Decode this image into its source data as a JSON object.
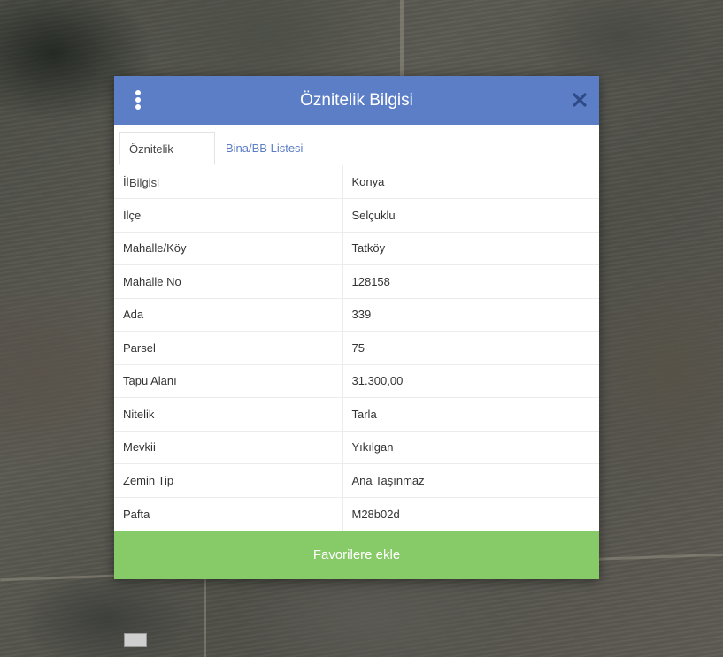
{
  "dialog": {
    "title": "Öznitelik Bilgisi",
    "tabs": [
      {
        "label": "Öznitelik Bilgisi",
        "active": true
      },
      {
        "label": "Bina/BB Listesi",
        "active": false
      }
    ],
    "rows": [
      {
        "key": "İl",
        "value": "Konya"
      },
      {
        "key": "İlçe",
        "value": "Selçuklu"
      },
      {
        "key": "Mahalle/Köy",
        "value": "Tatköy"
      },
      {
        "key": "Mahalle No",
        "value": "128158"
      },
      {
        "key": "Ada",
        "value": "339"
      },
      {
        "key": "Parsel",
        "value": "75"
      },
      {
        "key": "Tapu Alanı",
        "value": "31.300,00"
      },
      {
        "key": "Nitelik",
        "value": "Tarla"
      },
      {
        "key": "Mevkii",
        "value": "Yıkılgan"
      },
      {
        "key": "Zemin Tip",
        "value": "Ana Taşınmaz"
      },
      {
        "key": "Pafta",
        "value": "M28b02d"
      }
    ],
    "favorite_button_label": "Favorilere ekle",
    "icons": {
      "menu": "vertical-dots-icon",
      "close": "close-icon"
    }
  },
  "colors": {
    "header": "#5b7ec6",
    "tab_link": "#5b7ec6",
    "button": "#86cb67"
  }
}
